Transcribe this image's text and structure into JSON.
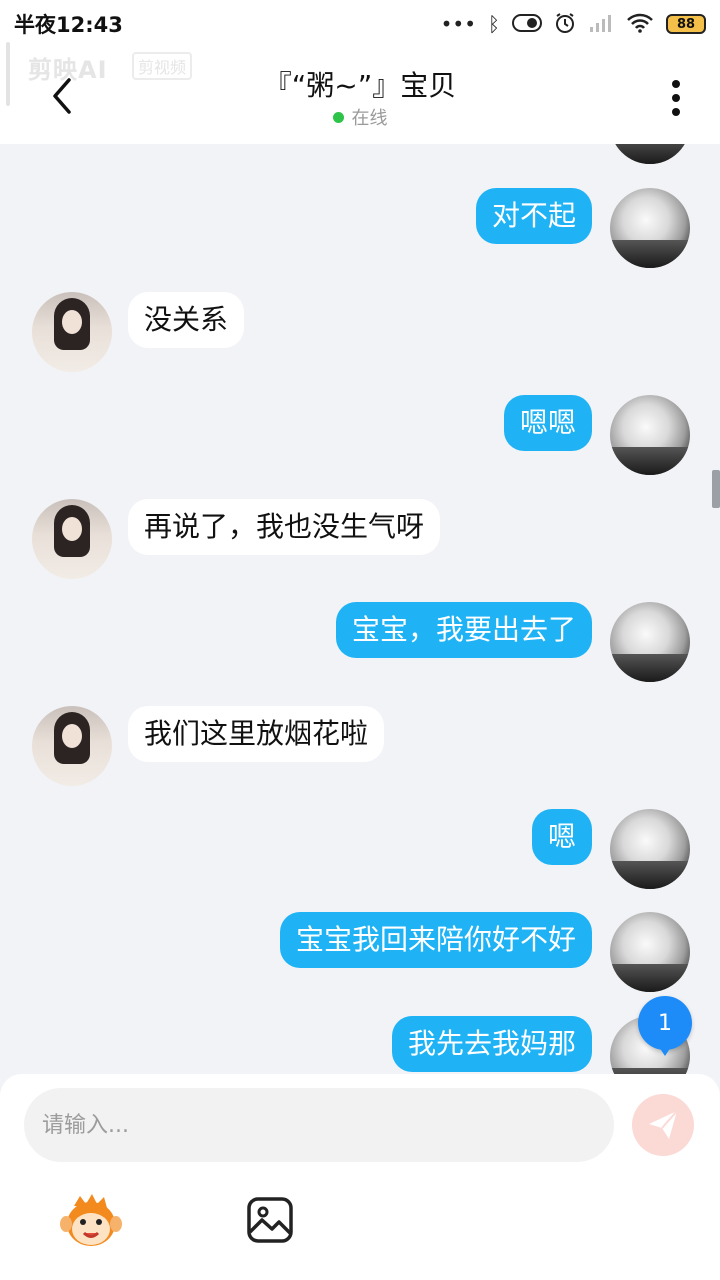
{
  "status_bar": {
    "time": "半夜12:43",
    "battery": "88",
    "icons": [
      "more-dots-icon",
      "bluetooth-icon",
      "toggle-icon",
      "alarm-icon",
      "signal-icon",
      "wifi-icon",
      "battery-icon"
    ]
  },
  "header": {
    "watermark": "剪映AI",
    "watermark_tag": "剪视频",
    "title": "『“粥~”』宝贝",
    "status": "在线"
  },
  "messages": [
    {
      "from": "me",
      "text": "对不起"
    },
    {
      "from": "her",
      "text": "没关系"
    },
    {
      "from": "me",
      "text": "嗯嗯"
    },
    {
      "from": "her",
      "text": "再说了，我也没生气呀"
    },
    {
      "from": "me",
      "text": "宝宝，我要出去了"
    },
    {
      "from": "her",
      "text": "我们这里放烟花啦"
    },
    {
      "from": "me",
      "text": "嗯"
    },
    {
      "from": "me",
      "text": "宝宝我回来陪你好不好"
    },
    {
      "from": "me",
      "text": "我先去我妈那"
    }
  ],
  "unread_badge": "1",
  "composer": {
    "placeholder": "请输入..."
  },
  "colors": {
    "outgoing_bubble": "#1fb3f5",
    "incoming_bubble": "#ffffff",
    "online_dot": "#2ec44a",
    "badge": "#1d8cf8",
    "send_button": "#fbd9d5"
  }
}
